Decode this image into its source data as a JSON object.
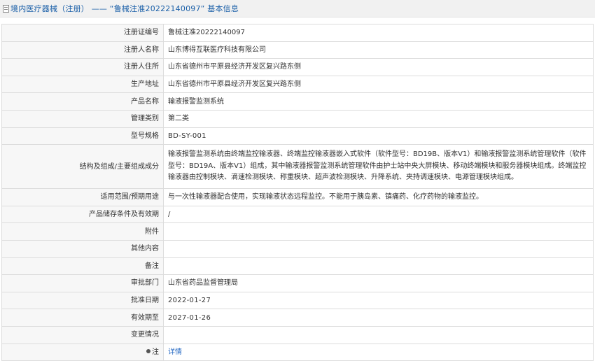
{
  "header": {
    "title": "境内医疗器械（注册） ——  “鲁械注准20222140097”  基本信息"
  },
  "rows": [
    {
      "label": "注册证编号",
      "value": "鲁械注准20222140097"
    },
    {
      "label": "注册人名称",
      "value": "山东博得互联医疗科技有限公司"
    },
    {
      "label": "注册人住所",
      "value": "山东省德州市平原县经济开发区复兴路东侧"
    },
    {
      "label": "生产地址",
      "value": "山东省德州市平原县经济开发区复兴路东侧"
    },
    {
      "label": "产品名称",
      "value": "输液报警监测系统"
    },
    {
      "label": "管理类别",
      "value": "第二类"
    },
    {
      "label": "型号规格",
      "value": "BD-SY-001"
    },
    {
      "label": "结构及组成/主要组成成分",
      "value": "输液报警监测系统由终端监控输液器、终端监控输液器嵌入式软件（软件型号：BD19B、版本V1）和输液报警监测系统管理软件（软件型号：BD19A、版本V1）组成，其中输液器报警监测系统管理软件由护士站中央大屏模块、移动终端模块和服务器模块组成。终端监控输液器由控制模块、滴速检测模块、称重模块、超声波检测模块、升降系统、夹持调速模块、电源管理模块组成。"
    },
    {
      "label": "适用范围/预期用途",
      "value": "与一次性输液器配合使用，实现输液状态远程监控。不能用于胰岛素、镇痛药、化疗药物的输液监控。"
    },
    {
      "label": "产品储存条件及有效期",
      "value": "/"
    },
    {
      "label": "附件",
      "value": ""
    },
    {
      "label": "其他内容",
      "value": ""
    },
    {
      "label": "备注",
      "value": ""
    },
    {
      "label": "审批部门",
      "value": "山东省药品监督管理局"
    },
    {
      "label": "批准日期",
      "value": "2022-01-27"
    },
    {
      "label": "有效期至",
      "value": "2027-01-26"
    },
    {
      "label": "变更情况",
      "value": ""
    },
    {
      "label": "注",
      "value": "详情"
    }
  ]
}
